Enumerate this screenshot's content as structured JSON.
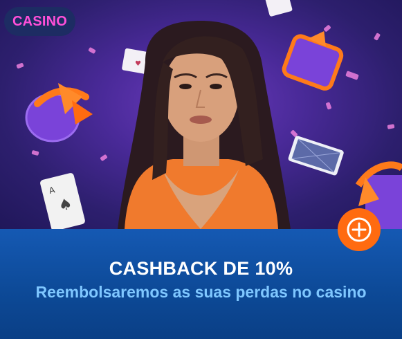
{
  "badge": {
    "label": "CASINO"
  },
  "promo": {
    "title": "CASHBACK DE 10%",
    "subtitle": "Reembolsaremos as suas perdas no casino"
  },
  "icons": {
    "expand": "plus-circle-icon"
  },
  "colors": {
    "accent_orange": "#ff6b10",
    "footer_blue": "#0d4a98",
    "subtitle_blue": "#7fc7ff",
    "badge_text": "#ff4fd8",
    "hero_purple": "#4a2a99"
  }
}
